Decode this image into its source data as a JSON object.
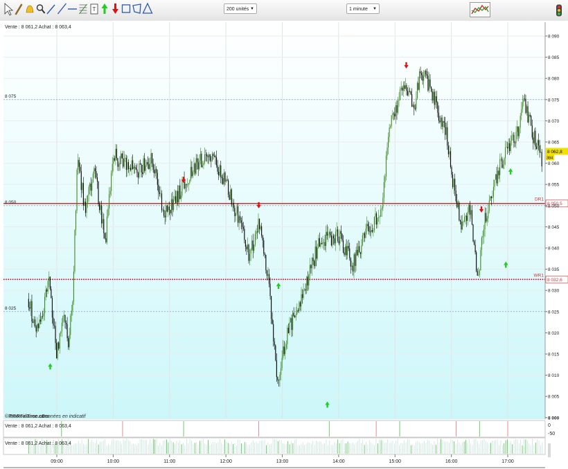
{
  "toolbar": {
    "tools": [
      "cursor-icon",
      "pencil-icon",
      "alert-bell-icon",
      "zoom-icon",
      "trend-line-icon",
      "ray-line-icon",
      "horizontal-line-icon",
      "fibonacci-icon",
      "note-icon",
      "buy-arrow-icon",
      "sell-arrow-icon",
      "rectangle-icon",
      "polygon-icon",
      "triangle-icon"
    ],
    "quantity_select": "200 unités",
    "period_select": "1 minute"
  },
  "colors": {
    "background_top": "#ffffff",
    "background_bottom": "#ccf7fa",
    "bull": "#3c8a1e",
    "bear": "#000000",
    "support_line": "#d03030",
    "dotted_level": "#d0021b",
    "grid_h": "#5a96c8",
    "buy_arrow": "#22cc22",
    "sell_arrow": "#dd1111",
    "last_price_bg": "#f2e000"
  },
  "header_text": "Vente : 8 061,2 Achat : 8 063,4",
  "watermark": {
    "brand": "©ProRealTime.com",
    "brand2": "BForFinance.com",
    "note": "Données en indicatif"
  },
  "chart_data": {
    "type": "candlestick",
    "x_tick_labels": [
      "09:00",
      "10:00",
      "11:00",
      "12:00",
      "13:00",
      "14:00",
      "15:00",
      "16:00",
      "17:00"
    ],
    "y_tick_labels": [
      "8 090",
      "8 085",
      "8 080",
      "8 075",
      "8 070",
      "8 065",
      "8 060",
      "8 055",
      "8 050",
      "8 045",
      "8 040",
      "8 035",
      "8 030",
      "8 025",
      "8 020",
      "8 015",
      "8 010",
      "8 005",
      "8 000"
    ],
    "y_range": [
      8000,
      8091
    ],
    "left_level_labels": [
      {
        "label": "8 075",
        "value": 8075
      },
      {
        "label": "8 050",
        "value": 8050
      },
      {
        "label": "8 025",
        "value": 8025
      }
    ],
    "levels": [
      {
        "name": "DR1",
        "value": 8050.5,
        "label": "8 050,5",
        "style": "solid"
      },
      {
        "name": "WR1",
        "value": 8032.6,
        "label": "8 032,6",
        "style": "dotted"
      }
    ],
    "last_price": {
      "value": 8062.8,
      "label": "8 062,8",
      "sub": "384"
    },
    "price_path": [
      [
        "08:30",
        8028
      ],
      [
        "08:37",
        8021
      ],
      [
        "08:45",
        8024
      ],
      [
        "08:51",
        8034
      ],
      [
        "08:55",
        8025
      ],
      [
        "09:00",
        8015
      ],
      [
        "09:07",
        8024
      ],
      [
        "09:12",
        8018
      ],
      [
        "09:17",
        8028
      ],
      [
        "09:22",
        8062
      ],
      [
        "09:30",
        8049
      ],
      [
        "09:40",
        8058
      ],
      [
        "09:52",
        8042
      ],
      [
        "10:00",
        8062
      ],
      [
        "10:10",
        8060
      ],
      [
        "10:25",
        8058
      ],
      [
        "10:40",
        8061
      ],
      [
        "10:55",
        8048
      ],
      [
        "11:05",
        8051
      ],
      [
        "11:20",
        8057
      ],
      [
        "11:35",
        8061
      ],
      [
        "11:50",
        8060
      ],
      [
        "12:00",
        8055
      ],
      [
        "12:15",
        8046
      ],
      [
        "12:25",
        8038
      ],
      [
        "12:35",
        8046
      ],
      [
        "12:45",
        8032
      ],
      [
        "12:55",
        8008
      ],
      [
        "13:05",
        8020
      ],
      [
        "13:20",
        8027
      ],
      [
        "13:40",
        8042
      ],
      [
        "14:00",
        8043
      ],
      [
        "14:15",
        8036
      ],
      [
        "14:30",
        8044
      ],
      [
        "14:45",
        8048
      ],
      [
        "14:55",
        8070
      ],
      [
        "15:10",
        8078
      ],
      [
        "15:20",
        8073
      ],
      [
        "15:28",
        8082
      ],
      [
        "15:40",
        8076
      ],
      [
        "15:55",
        8067
      ],
      [
        "16:00",
        8058
      ],
      [
        "16:10",
        8046
      ],
      [
        "16:20",
        8049
      ],
      [
        "16:28",
        8033
      ],
      [
        "16:35",
        8046
      ],
      [
        "16:50",
        8058
      ],
      [
        "17:00",
        8064
      ],
      [
        "17:10",
        8067
      ],
      [
        "17:18",
        8075
      ],
      [
        "17:25",
        8068
      ],
      [
        "17:37",
        8060
      ]
    ],
    "buy_signals": [
      "08:53",
      "12:56",
      "13:48",
      "16:58",
      "17:03"
    ],
    "sell_signals": [
      "11:15",
      "12:35",
      "15:12",
      "16:32"
    ],
    "buy_signal_prices": [
      8012,
      8031,
      8003,
      8036,
      8058
    ],
    "sell_signal_prices": [
      8056,
      8050,
      8083,
      8049
    ],
    "sub_panel_1": {
      "header": "Vente : 8 061,2 Achat : 8 063,4",
      "y_tick_labels": [
        "0",
        "-50"
      ],
      "markers": [
        "09:05",
        "10:10",
        "11:15",
        "12:35",
        "13:50",
        "14:40",
        "15:05",
        "16:05",
        "16:30",
        "17:00"
      ]
    },
    "sub_panel_2": {
      "header": "Vente : 8 061,2 Achat : 8 063,4"
    }
  }
}
